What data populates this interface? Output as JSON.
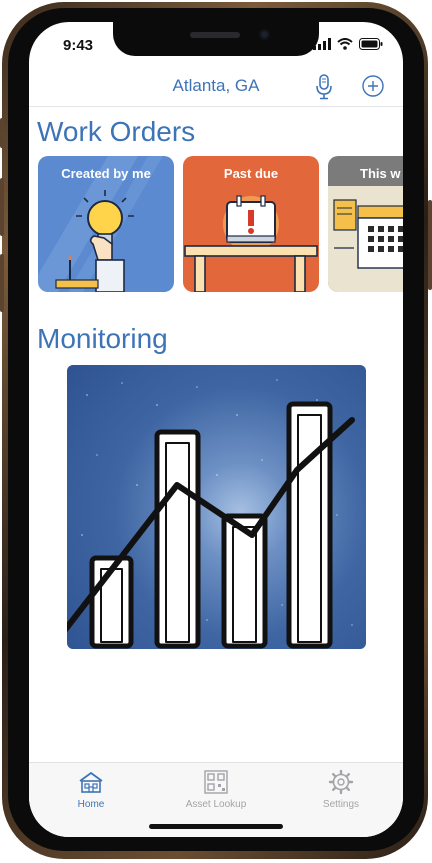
{
  "status_bar": {
    "time": "9:43"
  },
  "header": {
    "location": "Atlanta, GA"
  },
  "work_orders": {
    "title": "Work Orders",
    "cards": [
      {
        "label": "Created by me",
        "color": "#5b8ad0"
      },
      {
        "label": "Past due",
        "color": "#e2673a"
      },
      {
        "label": "This w",
        "color": "#7b7b7b"
      }
    ]
  },
  "monitoring": {
    "title": "Monitoring",
    "colors": {
      "background": "#3f66a3",
      "bars": "#ffffff",
      "line": "#111111"
    }
  },
  "tabbar": {
    "items": [
      {
        "label": "Home",
        "icon": "home-icon",
        "active": true
      },
      {
        "label": "Asset Lookup",
        "icon": "qr-code-icon",
        "active": false
      },
      {
        "label": "Settings",
        "icon": "gear-icon",
        "active": false
      }
    ]
  },
  "colors": {
    "accent": "#3d74b7",
    "inactive": "#a4a4a8"
  }
}
